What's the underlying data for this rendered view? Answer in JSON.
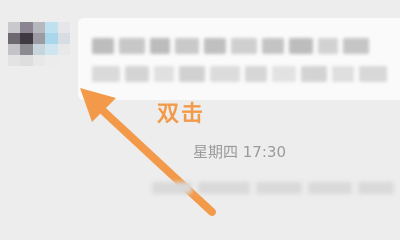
{
  "annotation": {
    "text": "双击",
    "color": "#f39a4a"
  },
  "message": {
    "timestamp": "星期四 17:30"
  },
  "icons": {
    "arrow": "arrow-up-left"
  }
}
